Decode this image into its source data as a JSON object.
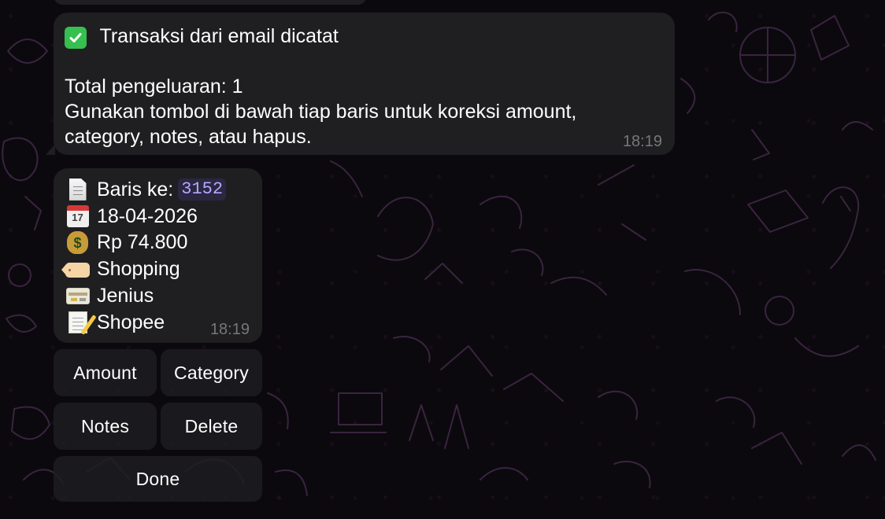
{
  "messages": [
    {
      "title": "Transaksi dari email dicatat",
      "total": "Total pengeluaran: 1",
      "instruction_line1": "Gunakan tombol di bawah tiap baris untuk koreksi amount,",
      "instruction_line2": "category, notes, atau hapus.",
      "time": "18:19"
    },
    {
      "row_label": "Baris ke:",
      "row_number": "3152",
      "date": "18-04-2026",
      "amount": "Rp 74.800",
      "category": "Shopping",
      "account": "Jenius",
      "notes": "Shopee",
      "time": "18:19"
    }
  ],
  "buttons": {
    "amount": "Amount",
    "category": "Category",
    "notes": "Notes",
    "delete": "Delete",
    "done": "Done"
  },
  "icons": {
    "check": "check-mark-icon",
    "document": "document-icon",
    "calendar": "calendar-icon",
    "money": "money-bag-icon",
    "tag": "tag-icon",
    "card": "credit-card-icon",
    "memo": "memo-icon"
  },
  "calendar_icon_day": "17",
  "colors": {
    "background": "#0b090d",
    "bubble": "#1f1f21",
    "timestamp": "#77777b",
    "badge": "#b8a7ff",
    "doodle": "#3a2440"
  }
}
